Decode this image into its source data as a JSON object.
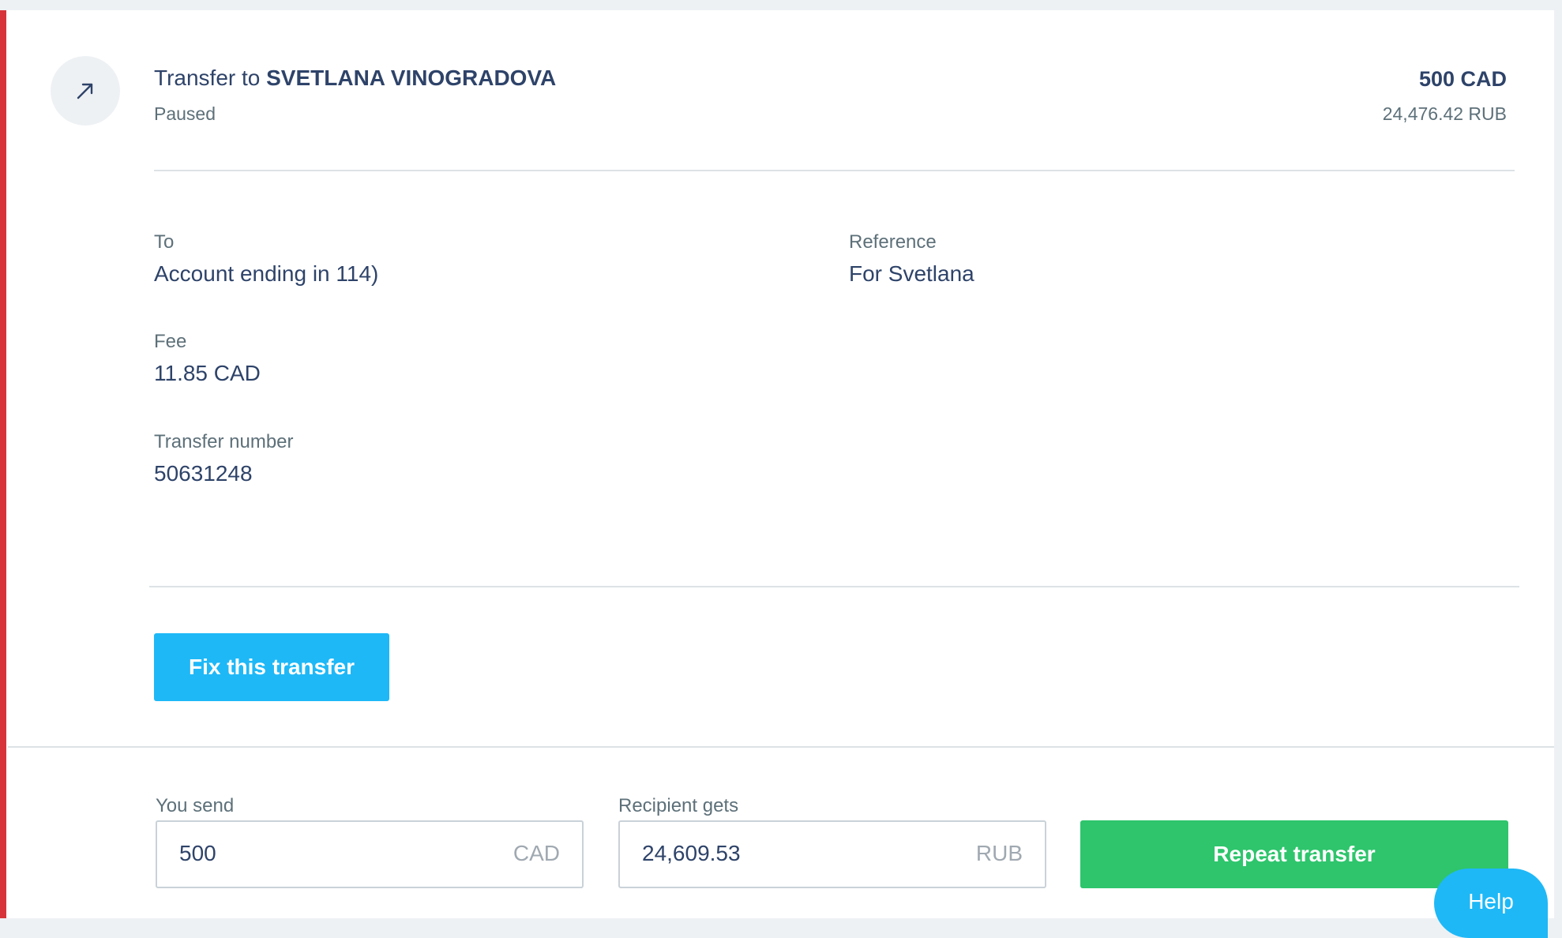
{
  "header": {
    "icon": "arrow-up-right-icon",
    "title_prefix": "Transfer to",
    "recipient": "SVETLANA VINOGRADOVA",
    "status": "Paused",
    "amount": "500 CAD",
    "converted_amount": "24,476.42 RUB"
  },
  "details": {
    "to_label": "To",
    "to_value": "Account ending in 114)",
    "reference_label": "Reference",
    "reference_value": "For Svetlana",
    "fee_label": "Fee",
    "fee_value": "11.85 CAD",
    "number_label": "Transfer number",
    "number_value": "50631248"
  },
  "actions": {
    "fix_label": "Fix this transfer"
  },
  "repeat": {
    "send_label": "You send",
    "send_value": "500",
    "send_currency": "CAD",
    "gets_label": "Recipient gets",
    "gets_value": "24,609.53",
    "gets_currency": "RUB",
    "button_label": "Repeat transfer"
  },
  "help": {
    "label": "Help"
  },
  "colors": {
    "status_bar": "#d6343a",
    "primary_blue": "#1eb8f7",
    "success_green": "#2ec56c",
    "text_navy": "#2e4369"
  }
}
